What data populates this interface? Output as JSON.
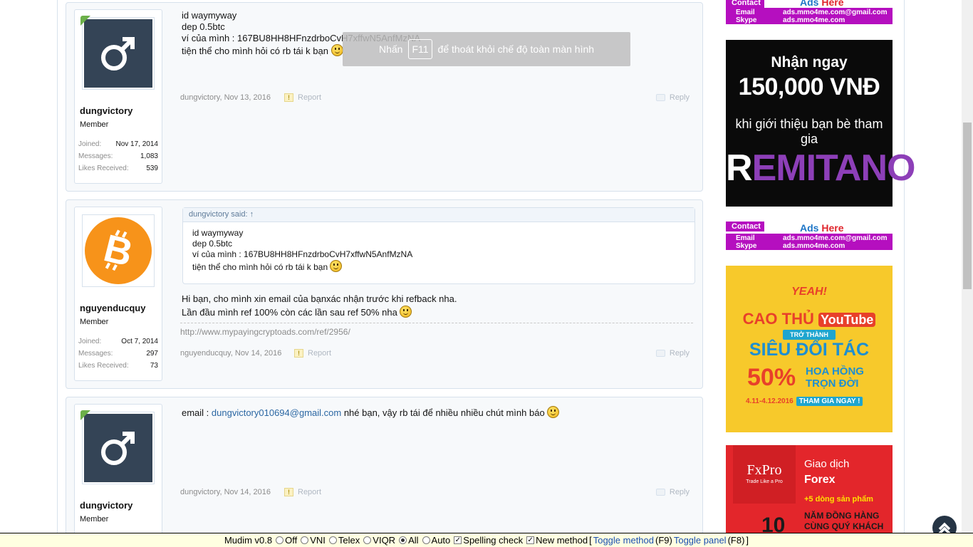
{
  "overlay": {
    "pre": "Nhấn",
    "key": "F11",
    "post": "để thoát khỏi chế độ toàn màn hình"
  },
  "stat_labels": {
    "joined": "Joined:",
    "messages": "Messages:",
    "likes": "Likes Received:"
  },
  "actions": {
    "report": "Report",
    "reply": "Reply"
  },
  "posts": [
    {
      "user": {
        "name": "dungvictory",
        "title": "Member",
        "joined": "Nov 17, 2014",
        "messages": "1,083",
        "likes": "539",
        "avatar": "male-symbol-icon",
        "online": true
      },
      "lines": [
        "id waymyway",
        "dep 0.5btc",
        "ví của mình : 167BU8HH8HFnzdrboCvH7xffwN5AnfMzNA",
        "tiện thể cho mình hỏi có rb tái k bạn"
      ],
      "author": "dungvictory",
      "date": "Nov 13, 2016"
    },
    {
      "user": {
        "name": "nguyenducquy",
        "title": "Member",
        "joined": "Oct 7, 2014",
        "messages": "297",
        "likes": "73",
        "avatar": "bitcoin-icon",
        "online": false
      },
      "quote": {
        "head": "dungvictory said: ↑",
        "lines": [
          "id waymyway",
          "dep 0.5btc",
          "ví của mình : 167BU8HH8HFnzdrboCvH7xffwN5AnfMzNA",
          "tiện thể cho mình hỏi có rb tái k bạn"
        ]
      },
      "lines": [
        "Hi bạn, cho mình xin email của bạnxác nhận trước khi refback nha.",
        "Lần đầu mình ref 100% còn các lần sau ref 50% nha"
      ],
      "signature": "http://www.mypayingcryptoads.com/ref/2956/",
      "author": "nguyenducquy",
      "date": "Nov 14, 2016"
    },
    {
      "user": {
        "name": "dungvictory",
        "title": "Member",
        "avatar": "male-symbol-icon",
        "online": true
      },
      "line_pre": "email : ",
      "email": "dungvictory010694@gmail.com",
      "line_post": " nhé bạn, vậy rb tái để nhiều nhiều chút mình báo",
      "author": "dungvictory",
      "date": "Nov 14, 2016"
    }
  ],
  "ads": {
    "contact": {
      "tag": "Contact",
      "here_a": "Ads",
      "here_b": "Here",
      "email_label": "Email",
      "email": "ads.mmo4me.com@gmail.com",
      "skype_label": "Skype",
      "skype": "ads.mmo4me.com"
    },
    "remitano": {
      "l1": "Nhận ngay",
      "l2": "150,000 VNĐ",
      "l3": "khi giới thiệu bạn bè tham gia",
      "l4a": "R",
      "l4b": "EMITANO"
    },
    "yeah": {
      "brand": "YEAH!",
      "l1a": "CAO THỦ",
      "l1b": "YouTube",
      "l2": "TRỞ THÀNH",
      "l3": "SIÊU ĐỐI TÁC",
      "l4": "50%",
      "l5a": "HOA HỒNG",
      "l5b": "TRỌN ĐỜI",
      "l6a": "4.11-4.12.2016",
      "l6b": "THAM GIA NGAY !"
    },
    "fxpro": {
      "name": "FxPro",
      "slogan": "Trade Like a Pro",
      "t1": "Giao dịch",
      "t2": "Forex",
      "t3": "+5 dòng sản phẩm",
      "t4a": "NĂM ĐỒNG HÀNG",
      "t4b": "CÙNG QUÝ KHÁCH",
      "t5": "10"
    }
  },
  "mudim": {
    "version": "Mudim v0.8",
    "options": [
      "Off",
      "VNI",
      "Telex",
      "VIQR",
      "All",
      "Auto"
    ],
    "selected": "All",
    "spelling": "Spelling check",
    "new_method": "New method",
    "toggle_method": "Toggle method",
    "toggle_method_key": "(F9)",
    "toggle_panel": "Toggle panel",
    "toggle_panel_key": "(F8)"
  }
}
